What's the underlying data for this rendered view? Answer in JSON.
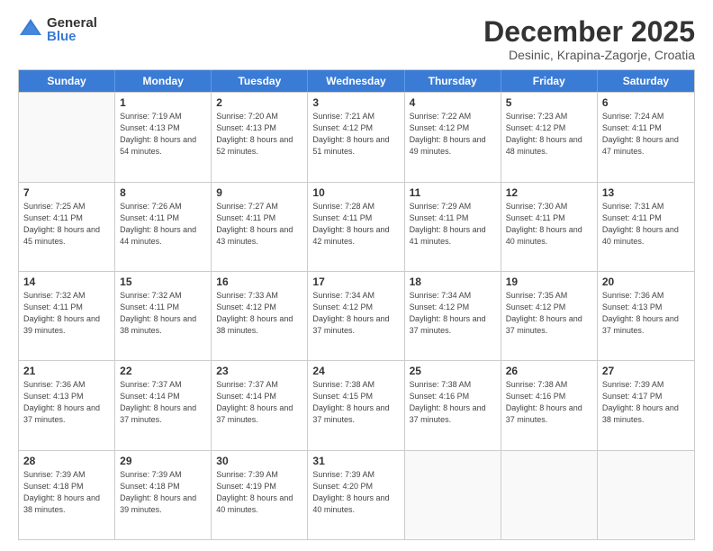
{
  "logo": {
    "general": "General",
    "blue": "Blue"
  },
  "header": {
    "month": "December 2025",
    "location": "Desinic, Krapina-Zagorje, Croatia"
  },
  "weekdays": [
    "Sunday",
    "Monday",
    "Tuesday",
    "Wednesday",
    "Thursday",
    "Friday",
    "Saturday"
  ],
  "weeks": [
    [
      {
        "day": "",
        "empty": true
      },
      {
        "day": "1",
        "sunrise": "Sunrise: 7:19 AM",
        "sunset": "Sunset: 4:13 PM",
        "daylight": "Daylight: 8 hours and 54 minutes."
      },
      {
        "day": "2",
        "sunrise": "Sunrise: 7:20 AM",
        "sunset": "Sunset: 4:13 PM",
        "daylight": "Daylight: 8 hours and 52 minutes."
      },
      {
        "day": "3",
        "sunrise": "Sunrise: 7:21 AM",
        "sunset": "Sunset: 4:12 PM",
        "daylight": "Daylight: 8 hours and 51 minutes."
      },
      {
        "day": "4",
        "sunrise": "Sunrise: 7:22 AM",
        "sunset": "Sunset: 4:12 PM",
        "daylight": "Daylight: 8 hours and 49 minutes."
      },
      {
        "day": "5",
        "sunrise": "Sunrise: 7:23 AM",
        "sunset": "Sunset: 4:12 PM",
        "daylight": "Daylight: 8 hours and 48 minutes."
      },
      {
        "day": "6",
        "sunrise": "Sunrise: 7:24 AM",
        "sunset": "Sunset: 4:11 PM",
        "daylight": "Daylight: 8 hours and 47 minutes."
      }
    ],
    [
      {
        "day": "7",
        "sunrise": "Sunrise: 7:25 AM",
        "sunset": "Sunset: 4:11 PM",
        "daylight": "Daylight: 8 hours and 45 minutes."
      },
      {
        "day": "8",
        "sunrise": "Sunrise: 7:26 AM",
        "sunset": "Sunset: 4:11 PM",
        "daylight": "Daylight: 8 hours and 44 minutes."
      },
      {
        "day": "9",
        "sunrise": "Sunrise: 7:27 AM",
        "sunset": "Sunset: 4:11 PM",
        "daylight": "Daylight: 8 hours and 43 minutes."
      },
      {
        "day": "10",
        "sunrise": "Sunrise: 7:28 AM",
        "sunset": "Sunset: 4:11 PM",
        "daylight": "Daylight: 8 hours and 42 minutes."
      },
      {
        "day": "11",
        "sunrise": "Sunrise: 7:29 AM",
        "sunset": "Sunset: 4:11 PM",
        "daylight": "Daylight: 8 hours and 41 minutes."
      },
      {
        "day": "12",
        "sunrise": "Sunrise: 7:30 AM",
        "sunset": "Sunset: 4:11 PM",
        "daylight": "Daylight: 8 hours and 40 minutes."
      },
      {
        "day": "13",
        "sunrise": "Sunrise: 7:31 AM",
        "sunset": "Sunset: 4:11 PM",
        "daylight": "Daylight: 8 hours and 40 minutes."
      }
    ],
    [
      {
        "day": "14",
        "sunrise": "Sunrise: 7:32 AM",
        "sunset": "Sunset: 4:11 PM",
        "daylight": "Daylight: 8 hours and 39 minutes."
      },
      {
        "day": "15",
        "sunrise": "Sunrise: 7:32 AM",
        "sunset": "Sunset: 4:11 PM",
        "daylight": "Daylight: 8 hours and 38 minutes."
      },
      {
        "day": "16",
        "sunrise": "Sunrise: 7:33 AM",
        "sunset": "Sunset: 4:12 PM",
        "daylight": "Daylight: 8 hours and 38 minutes."
      },
      {
        "day": "17",
        "sunrise": "Sunrise: 7:34 AM",
        "sunset": "Sunset: 4:12 PM",
        "daylight": "Daylight: 8 hours and 37 minutes."
      },
      {
        "day": "18",
        "sunrise": "Sunrise: 7:34 AM",
        "sunset": "Sunset: 4:12 PM",
        "daylight": "Daylight: 8 hours and 37 minutes."
      },
      {
        "day": "19",
        "sunrise": "Sunrise: 7:35 AM",
        "sunset": "Sunset: 4:12 PM",
        "daylight": "Daylight: 8 hours and 37 minutes."
      },
      {
        "day": "20",
        "sunrise": "Sunrise: 7:36 AM",
        "sunset": "Sunset: 4:13 PM",
        "daylight": "Daylight: 8 hours and 37 minutes."
      }
    ],
    [
      {
        "day": "21",
        "sunrise": "Sunrise: 7:36 AM",
        "sunset": "Sunset: 4:13 PM",
        "daylight": "Daylight: 8 hours and 37 minutes."
      },
      {
        "day": "22",
        "sunrise": "Sunrise: 7:37 AM",
        "sunset": "Sunset: 4:14 PM",
        "daylight": "Daylight: 8 hours and 37 minutes."
      },
      {
        "day": "23",
        "sunrise": "Sunrise: 7:37 AM",
        "sunset": "Sunset: 4:14 PM",
        "daylight": "Daylight: 8 hours and 37 minutes."
      },
      {
        "day": "24",
        "sunrise": "Sunrise: 7:38 AM",
        "sunset": "Sunset: 4:15 PM",
        "daylight": "Daylight: 8 hours and 37 minutes."
      },
      {
        "day": "25",
        "sunrise": "Sunrise: 7:38 AM",
        "sunset": "Sunset: 4:16 PM",
        "daylight": "Daylight: 8 hours and 37 minutes."
      },
      {
        "day": "26",
        "sunrise": "Sunrise: 7:38 AM",
        "sunset": "Sunset: 4:16 PM",
        "daylight": "Daylight: 8 hours and 37 minutes."
      },
      {
        "day": "27",
        "sunrise": "Sunrise: 7:39 AM",
        "sunset": "Sunset: 4:17 PM",
        "daylight": "Daylight: 8 hours and 38 minutes."
      }
    ],
    [
      {
        "day": "28",
        "sunrise": "Sunrise: 7:39 AM",
        "sunset": "Sunset: 4:18 PM",
        "daylight": "Daylight: 8 hours and 38 minutes."
      },
      {
        "day": "29",
        "sunrise": "Sunrise: 7:39 AM",
        "sunset": "Sunset: 4:18 PM",
        "daylight": "Daylight: 8 hours and 39 minutes."
      },
      {
        "day": "30",
        "sunrise": "Sunrise: 7:39 AM",
        "sunset": "Sunset: 4:19 PM",
        "daylight": "Daylight: 8 hours and 40 minutes."
      },
      {
        "day": "31",
        "sunrise": "Sunrise: 7:39 AM",
        "sunset": "Sunset: 4:20 PM",
        "daylight": "Daylight: 8 hours and 40 minutes."
      },
      {
        "day": "",
        "empty": true
      },
      {
        "day": "",
        "empty": true
      },
      {
        "day": "",
        "empty": true
      }
    ]
  ]
}
